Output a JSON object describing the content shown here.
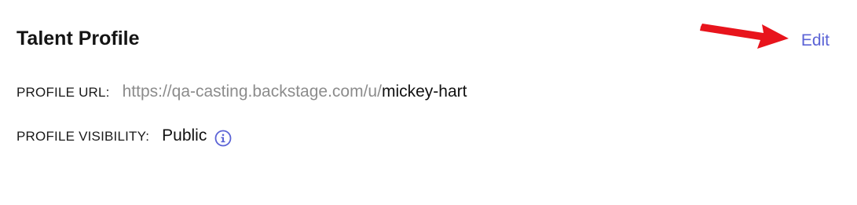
{
  "profile": {
    "title": "Talent Profile",
    "edit_label": "Edit",
    "url_label": "PROFILE URL:",
    "url_base": "https://qa-casting.backstage.com/u/",
    "url_slug": "mickey-hart",
    "visibility_label": "PROFILE VISIBILITY:",
    "visibility_value": "Public"
  },
  "icons": {
    "visibility_info": "info-icon",
    "annotation": "red-arrow-icon"
  },
  "colors": {
    "link": "#5b63d6",
    "arrow": "#e8141c",
    "muted_text": "#8c8c8c"
  }
}
